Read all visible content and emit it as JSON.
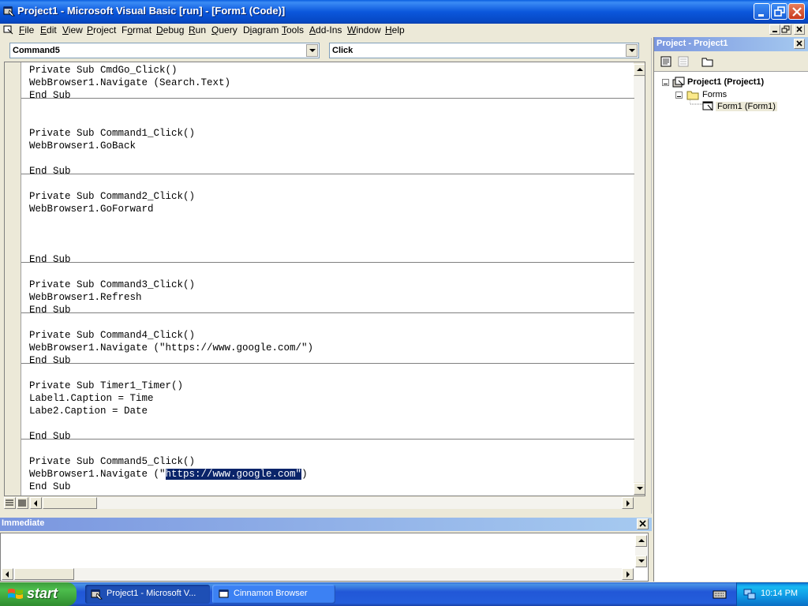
{
  "window": {
    "title": "Project1 - Microsoft Visual Basic [run] - [Form1 (Code)]",
    "app_icon": "vb6-icon",
    "caption_buttons": [
      "minimize-icon",
      "restore-icon",
      "close-icon"
    ]
  },
  "menubar": {
    "items": [
      {
        "label": "File",
        "accel": "F"
      },
      {
        "label": "Edit",
        "accel": "E"
      },
      {
        "label": "View",
        "accel": "V"
      },
      {
        "label": "Project",
        "accel": "P"
      },
      {
        "label": "Format",
        "accel": "o"
      },
      {
        "label": "Debug",
        "accel": "D"
      },
      {
        "label": "Run",
        "accel": "R"
      },
      {
        "label": "Query",
        "accel": "Q"
      },
      {
        "label": "Diagram",
        "accel": "i"
      },
      {
        "label": "Tools",
        "accel": "T"
      },
      {
        "label": "Add-Ins",
        "accel": "A"
      },
      {
        "label": "Window",
        "accel": "W"
      },
      {
        "label": "Help",
        "accel": "H"
      }
    ]
  },
  "code_window": {
    "object_combo": "Command5",
    "procedure_combo": "Click",
    "procedures": [
      {
        "lines": [
          "Private Sub CmdGo_Click()",
          "WebBrowser1.Navigate (Search.Text)",
          "End Sub"
        ]
      },
      {
        "lines": [
          "",
          "",
          "Private Sub Command1_Click()",
          "WebBrowser1.GoBack",
          "",
          "End Sub"
        ]
      },
      {
        "lines": [
          "",
          "Private Sub Command2_Click()",
          "WebBrowser1.GoForward",
          "",
          "",
          "",
          "End Sub"
        ]
      },
      {
        "lines": [
          "",
          "Private Sub Command3_Click()",
          "WebBrowser1.Refresh",
          "End Sub"
        ]
      },
      {
        "lines": [
          "",
          "Private Sub Command4_Click()",
          "WebBrowser1.Navigate (\"https://www.google.com/\")",
          "End Sub"
        ]
      },
      {
        "lines": [
          "",
          "Private Sub Timer1_Timer()",
          "Label1.Caption = Time",
          "Labe2.Caption = Date",
          "",
          "End Sub"
        ]
      },
      {
        "lines": [
          "",
          "Private Sub Command5_Click()",
          "WebBrowser1.Navigate (\"",
          "End Sub"
        ]
      }
    ],
    "selected_line_prefix": "WebBrowser1.Navigate (\"",
    "selected_text": "https://www.google.com\"",
    "selected_line_suffix": ")"
  },
  "project_explorer": {
    "title": "Project - Project1",
    "toolbar": [
      "view-code-icon",
      "view-object-icon",
      "toggle-folders-icon"
    ],
    "tree": {
      "project": "Project1 (Project1)",
      "folder": "Forms",
      "form": "Form1 (Form1)"
    }
  },
  "immediate": {
    "title": "Immediate",
    "content": ""
  },
  "taskbar": {
    "start_label": "start",
    "buttons": [
      {
        "label": "Project1 - Microsoft V...",
        "icon": "vb6-icon",
        "active": true
      },
      {
        "label": "Cinnamon Browser",
        "icon": "form-window-icon",
        "active": false
      }
    ],
    "clock": "10:14 PM"
  },
  "colors": {
    "titlebar": "#0b57dc",
    "selection": "#0a246a",
    "panel_title": "#7a96df",
    "taskbar": "#245edb",
    "start": "#3c9c3c"
  }
}
